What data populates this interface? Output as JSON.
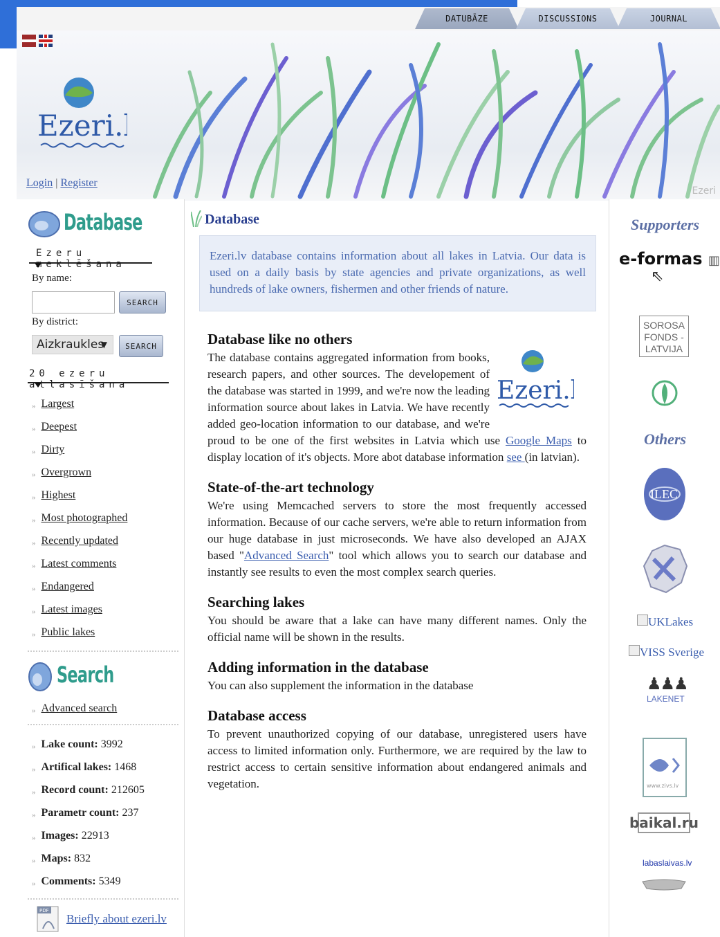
{
  "nav": {
    "tabs": [
      "DATUBĀZE",
      "DISCUSSIONS",
      "JOURNAL"
    ]
  },
  "header": {
    "logo_text": "Ezeri.lv",
    "login": "Login",
    "separator": "|",
    "register": "Register",
    "watermark": "Ezeri"
  },
  "sidebar": {
    "database_title": "Database",
    "search_heading": "Ezeru meklēšana",
    "by_name_label": "By name:",
    "search_button": "SEARCH",
    "by_district_label": "By district:",
    "district_value": "Aizkraukles",
    "search_button2": "SEARCH",
    "top20_heading": "20 ezeru atlasīšana",
    "links": [
      "Largest",
      "Deepest",
      "Dirty",
      "Overgrown",
      "Highest",
      "Most photographed",
      "Recently updated",
      "Latest comments",
      "Endangered",
      "Latest images",
      "Public lakes"
    ],
    "search_title": "Search",
    "advanced_search": "Advanced search",
    "stats": [
      {
        "label": "Lake count:",
        "value": "3992"
      },
      {
        "label": "Artifical lakes:",
        "value": "1468"
      },
      {
        "label": "Record count:",
        "value": "212605"
      },
      {
        "label": "Parametr count:",
        "value": "237"
      },
      {
        "label": "Images:",
        "value": "22913"
      },
      {
        "label": "Maps:",
        "value": "832"
      },
      {
        "label": "Comments:",
        "value": "5349"
      }
    ],
    "pdf_icon_text": "PDF",
    "briefly": "Briefly about ezeri.lv"
  },
  "main": {
    "title": "Database",
    "intro": "Ezeri.lv database contains information about all lakes in Latvia. Our data is used on a daily basis by state agencies and private organizations, as well hundreds of lake owners, fishermen and other friends of nature.",
    "s1_title": "Database like no others",
    "s1_text_a": "The database contains aggregated information from books, research papers, and other sources. The developement of the database was started in 1999, and we're now the leading information source about lakes in Latvia. We have recently added geo-location information to our database, and we're proud to be one of the first websites in Latvia which use ",
    "s1_link1": "Google Maps",
    "s1_text_b": " to display location of it's objects. More abot database information ",
    "s1_link2": "see ",
    "s1_text_c": "(in latvian).",
    "s2_title": "State-of-the-art technology",
    "s2_text_a": "We're using Memcached servers to store the most frequently accessed information. Because of our cache servers, we're able to return information from our huge database in just microseconds. We have also developed an AJAX based \"",
    "s2_link": "Advanced Search",
    "s2_text_b": "\" tool which allows you to search our database and instantly see results to even the most complex search queries.",
    "s3_title": "Searching lakes",
    "s3_text": "You should be aware that a lake can have many different names. Only the official name will be shown in the results.",
    "s4_title": "Adding information in the database",
    "s4_text": "You can also supplement the information in the database",
    "s5_title": "Database access",
    "s5_text": "To prevent unauthorized copying of our database, unregistered users have access to limited information only. Furthermore, we are required by the law to restrict access to certain sensitive information about endangered animals and vegetation."
  },
  "right": {
    "supporters": "Supporters",
    "eformas": "e-formas",
    "soros": "SOROSA FONDS - LATVIJA",
    "others": "Others",
    "ilec": "ILEC",
    "uklakes": "UKLakes",
    "viss": "VISS Sverige",
    "laekenet": "LAKENET",
    "zivs": "www.zivs.lv",
    "baikal": "baikal.ru",
    "labas": "labaslaivas.lv"
  }
}
